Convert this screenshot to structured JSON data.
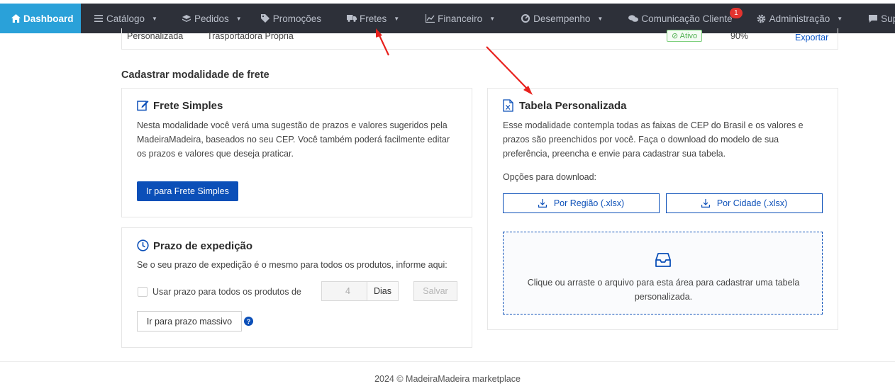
{
  "nav": {
    "dashboard": "Dashboard",
    "catalogo": "Catálogo",
    "pedidos": "Pedidos",
    "promocoes": "Promoções",
    "fretes": "Fretes",
    "financeiro": "Financeiro",
    "desempenho": "Desempenho",
    "comunicacao": "Comunicação Cliente",
    "comunicacao_badge": "1",
    "administracao": "Administração",
    "suporte": "Suporte"
  },
  "table_row": {
    "modalidade": "Personalizada",
    "transportadora": "Trasportadora Própria",
    "status": "Ativo",
    "percent": "90%",
    "action": "Exportar"
  },
  "section_title": "Cadastrar modalidade de frete",
  "frete_simples": {
    "title": "Frete Simples",
    "text": "Nesta modalidade você verá uma sugestão de prazos e valores sugeridos pela MadeiraMadeira, baseados no seu CEP. Você também poderá facilmente editar os prazos e valores que deseja praticar.",
    "button": "Ir para Frete Simples"
  },
  "prazo": {
    "title": "Prazo de expedição",
    "text": "Se o seu prazo de expedição é o mesmo para todos os produtos, informe aqui:",
    "checkbox_label": "Usar prazo para todos os produtos de",
    "days_value": "4",
    "days_unit": "Dias",
    "save": "Salvar",
    "massivo": "Ir para prazo massivo",
    "help": "?"
  },
  "tabela": {
    "title": "Tabela Personalizada",
    "text": "Esse modalidade contempla todas as faixas de CEP do Brasil e os valores e prazos são preenchidos por você. Faça o download do modelo de sua preferência, preencha e envie para cadastrar sua tabela.",
    "download_label": "Opções para download:",
    "btn_regiao": "Por Região (.xlsx)",
    "btn_cidade": "Por Cidade (.xlsx)",
    "dropzone_text": "Clique ou arraste o arquivo para esta área para cadastrar uma tabela personalizada."
  },
  "footer": "2024 © MadeiraMadeira marketplace",
  "colors": {
    "nav_bg": "#2d3039",
    "dashboard_bg": "#2aa1d9",
    "primary": "#0b4fb8",
    "annotation": "#e8211d"
  }
}
